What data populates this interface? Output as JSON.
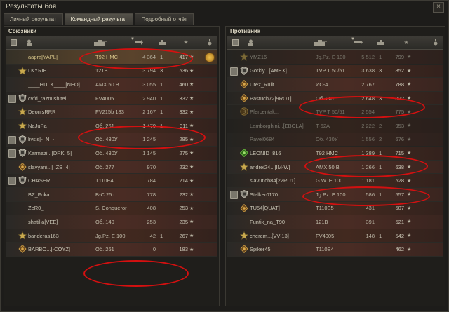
{
  "window": {
    "title": "Результаты боя",
    "close_glyph": "×"
  },
  "tabs": [
    "Личный результат",
    "Командный результат",
    "Подробный отчёт"
  ],
  "active_tab": 1,
  "left": {
    "title": "Союзники",
    "rows": [
      {
        "name": "aapra[YAPL]",
        "tank": "T92 HMC",
        "damage": "4 364",
        "kills": "1",
        "xp": "417",
        "self": true,
        "medal": true,
        "badge": ""
      },
      {
        "name": "LKYRIE",
        "tank": "121B",
        "damage": "3 794",
        "kills": "3",
        "xp": "536",
        "badge": "star"
      },
      {
        "name": "____HULK____[NEO]",
        "tank": "AMX 50 B",
        "damage": "3 055",
        "kills": "1",
        "xp": "460",
        "badge": ""
      },
      {
        "name": "cvfd_raznushitel",
        "tank": "FV4005",
        "damage": "2 940",
        "kills": "1",
        "xp": "332",
        "badge": "shield"
      },
      {
        "name": "DeonisRRR",
        "tank": "FV215b 183",
        "damage": "2 167",
        "kills": "1",
        "xp": "332",
        "badge": "star"
      },
      {
        "name": "NaJuPa",
        "tank": "Об. 261",
        "damage": "1 479",
        "kills": "1",
        "xp": "311",
        "badge": "star"
      },
      {
        "name": "livsis[-_N_-]",
        "tank": "Об. 430У",
        "damage": "1 245",
        "kills": "",
        "xp": "285",
        "badge": "shield"
      },
      {
        "name": "Karmezi...[DRK_5]",
        "tank": "Об. 430У",
        "damage": "1 145",
        "kills": "",
        "xp": "275",
        "badge": "shield"
      },
      {
        "name": "slavyani...[_ZS_4]",
        "tank": "Об. 277",
        "damage": "970",
        "kills": "",
        "xp": "232",
        "badge": "gear"
      },
      {
        "name": "CHASER",
        "tank": "T110E4",
        "damage": "784",
        "kills": "",
        "xp": "214",
        "badge": "shield"
      },
      {
        "name": "BZ_Foka",
        "tank": "B-C 25 t",
        "damage": "778",
        "kills": "",
        "xp": "232",
        "badge": ""
      },
      {
        "name": "ZeR0_",
        "tank": "S. Conqueror",
        "damage": "408",
        "kills": "",
        "xp": "253",
        "badge": ""
      },
      {
        "name": "shatilla[VEE]",
        "tank": "Об. 140",
        "damage": "253",
        "kills": "",
        "xp": "235",
        "badge": ""
      },
      {
        "name": "banderas163",
        "tank": "Jg.Pz. E 100",
        "damage": "42",
        "kills": "1",
        "xp": "267",
        "badge": "star"
      },
      {
        "name": "BARBO...[-COYZ]",
        "tank": "Об. 261",
        "damage": "0",
        "kills": "",
        "xp": "183",
        "badge": "gear"
      }
    ]
  },
  "right": {
    "title": "Противник",
    "rows": [
      {
        "name": "YMZ16",
        "tank": "Jg.Pz. E 100",
        "damage": "5 512",
        "kills": "1",
        "xp": "799",
        "badge": "star",
        "dead": true
      },
      {
        "name": "Gorkiy...[AMEX]",
        "tank": "TVP T 50/51",
        "damage": "3 638",
        "kills": "3",
        "xp": "852",
        "badge": "shield"
      },
      {
        "name": "Urez_Rulit",
        "tank": "ИС-4",
        "damage": "2 767",
        "kills": "",
        "xp": "788",
        "badge": "gear"
      },
      {
        "name": "Pastuch72[9ROT]",
        "tank": "Об. 261",
        "damage": "2 648",
        "kills": "3",
        "xp": "822",
        "badge": "gear"
      },
      {
        "name": "Pfercentak...",
        "tank": "TVP T 50/51",
        "damage": "2 554",
        "kills": "",
        "xp": "775",
        "badge": "b",
        "dead": true
      },
      {
        "name": "Lamborghini...[EBOLA]",
        "tank": "T-62A",
        "damage": "2 222",
        "kills": "2",
        "xp": "953",
        "badge": "",
        "dead": true
      },
      {
        "name": "Pavel0684",
        "tank": "Об. 430У",
        "damage": "1 556",
        "kills": "2",
        "xp": "676",
        "badge": "",
        "dead": true
      },
      {
        "name": "LEONID_816",
        "tank": "T92 HMC",
        "damage": "1 389",
        "kills": "1",
        "xp": "715",
        "badge": "green"
      },
      {
        "name": "andrei24...[IM-W]",
        "tank": "AMX 50 B",
        "damage": "1 266",
        "kills": "1",
        "xp": "638",
        "badge": "star"
      },
      {
        "name": "slavutich84[22RU1]",
        "tank": "G.W. E 100",
        "damage": "1 181",
        "kills": "",
        "xp": "528",
        "badge": ""
      },
      {
        "name": "Stalker0170",
        "tank": "Jg.Pz. E 100",
        "damage": "586",
        "kills": "1",
        "xp": "557",
        "badge": "shield"
      },
      {
        "name": "TU54[QUAT]",
        "tank": "T110E5",
        "damage": "431",
        "kills": "",
        "xp": "507",
        "badge": "gear"
      },
      {
        "name": "Funtik_na_T90",
        "tank": "121B",
        "damage": "391",
        "kills": "",
        "xp": "521",
        "badge": ""
      },
      {
        "name": "cherem...[VV-13]",
        "tank": "FV4005",
        "damage": "148",
        "kills": "1",
        "xp": "542",
        "badge": "star"
      },
      {
        "name": "Spiker45",
        "tank": "T110E4",
        "damage": "",
        "kills": "",
        "xp": "462",
        "badge": "gear"
      }
    ]
  },
  "colors": {
    "annotation": "#d41010",
    "row_red": "#4a2c24"
  }
}
